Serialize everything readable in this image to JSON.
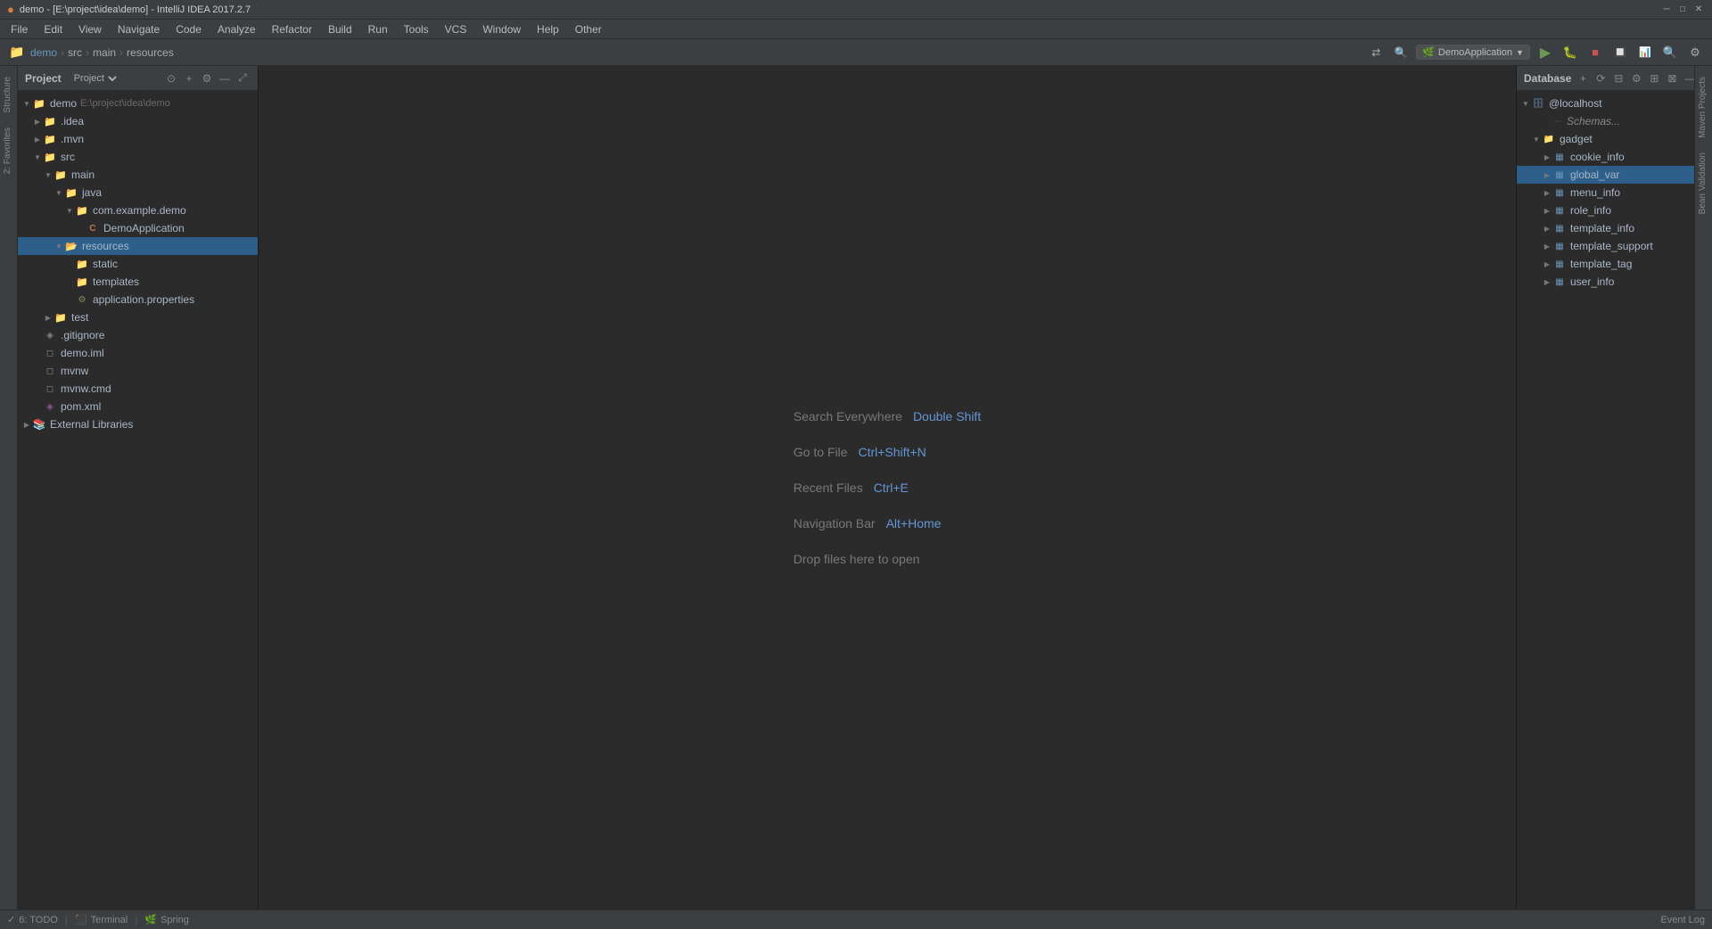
{
  "titleBar": {
    "title": "demo - [E:\\project\\idea\\demo] - IntelliJ IDEA 2017.2.7",
    "controls": [
      "─",
      "□",
      "✕"
    ]
  },
  "menuBar": {
    "items": [
      "File",
      "Edit",
      "View",
      "Navigate",
      "Code",
      "Analyze",
      "Refactor",
      "Build",
      "Run",
      "Tools",
      "VCS",
      "Window",
      "Help",
      "Other"
    ]
  },
  "toolbar": {
    "breadcrumb": [
      "demo",
      "src",
      "main",
      "resources"
    ],
    "runConfig": "DemoApplication",
    "buttons": [
      "▶",
      "🐛",
      "⏹",
      "⟳",
      "📊",
      "🔍"
    ]
  },
  "projectPanel": {
    "title": "Project",
    "tree": [
      {
        "indent": 0,
        "arrow": "open",
        "icon": "folder",
        "label": "demo",
        "sublabel": "E:\\project\\idea\\demo"
      },
      {
        "indent": 1,
        "arrow": "open",
        "icon": "folder",
        "label": ".idea"
      },
      {
        "indent": 1,
        "arrow": "closed",
        "icon": "folder",
        "label": ".mvn"
      },
      {
        "indent": 1,
        "arrow": "open",
        "icon": "folder",
        "label": "src"
      },
      {
        "indent": 2,
        "arrow": "open",
        "icon": "folder",
        "label": "main"
      },
      {
        "indent": 3,
        "arrow": "open",
        "icon": "folder",
        "label": "java"
      },
      {
        "indent": 4,
        "arrow": "open",
        "icon": "folder",
        "label": "com.example.demo"
      },
      {
        "indent": 5,
        "arrow": "empty",
        "icon": "java",
        "label": "DemoApplication"
      },
      {
        "indent": 3,
        "arrow": "open",
        "icon": "folder-selected",
        "label": "resources",
        "selected": true
      },
      {
        "indent": 4,
        "arrow": "empty",
        "icon": "folder",
        "label": "static"
      },
      {
        "indent": 4,
        "arrow": "empty",
        "icon": "folder",
        "label": "templates"
      },
      {
        "indent": 4,
        "arrow": "empty",
        "icon": "properties",
        "label": "application.properties"
      },
      {
        "indent": 2,
        "arrow": "closed",
        "icon": "folder",
        "label": "test"
      },
      {
        "indent": 1,
        "arrow": "empty",
        "icon": "gitignore",
        "label": ".gitignore"
      },
      {
        "indent": 1,
        "arrow": "empty",
        "icon": "file",
        "label": "demo.iml"
      },
      {
        "indent": 1,
        "arrow": "empty",
        "icon": "file",
        "label": "mvnw"
      },
      {
        "indent": 1,
        "arrow": "empty",
        "icon": "file",
        "label": "mvnw.cmd"
      },
      {
        "indent": 1,
        "arrow": "empty",
        "icon": "xml",
        "label": "pom.xml"
      },
      {
        "indent": 0,
        "arrow": "closed",
        "icon": "folder",
        "label": "External Libraries"
      }
    ]
  },
  "editor": {
    "hints": [
      {
        "label": "Search Everywhere",
        "shortcut": "Double Shift"
      },
      {
        "label": "Go to File",
        "shortcut": "Ctrl+Shift+N"
      },
      {
        "label": "Recent Files",
        "shortcut": "Ctrl+E"
      },
      {
        "label": "Navigation Bar",
        "shortcut": "Alt+Home"
      },
      {
        "label": "Drop files here to open",
        "shortcut": ""
      }
    ]
  },
  "databasePanel": {
    "title": "Database",
    "host": "@localhost",
    "schemas": "Schemas...",
    "tree": [
      {
        "indent": 0,
        "arrow": "open",
        "icon": "db",
        "label": "@localhost"
      },
      {
        "indent": 1,
        "arrow": "empty",
        "icon": "schema",
        "label": "Schemas..."
      },
      {
        "indent": 1,
        "arrow": "open",
        "icon": "folder",
        "label": "gadget"
      },
      {
        "indent": 2,
        "arrow": "empty",
        "icon": "table",
        "label": "cookie_info",
        "selected": false
      },
      {
        "indent": 2,
        "arrow": "empty",
        "icon": "table",
        "label": "global_var",
        "selected": true
      },
      {
        "indent": 2,
        "arrow": "empty",
        "icon": "table",
        "label": "menu_info"
      },
      {
        "indent": 2,
        "arrow": "empty",
        "icon": "table",
        "label": "role_info"
      },
      {
        "indent": 2,
        "arrow": "empty",
        "icon": "table",
        "label": "template_info"
      },
      {
        "indent": 2,
        "arrow": "empty",
        "icon": "table",
        "label": "template_support"
      },
      {
        "indent": 2,
        "arrow": "empty",
        "icon": "table",
        "label": "template_tag"
      },
      {
        "indent": 2,
        "arrow": "empty",
        "icon": "table",
        "label": "user_info"
      }
    ]
  },
  "rightSideTabs": [
    "Maven Projects",
    "Bean Validation"
  ],
  "leftSideTabs": [
    "Structure",
    "2: Favorites"
  ],
  "statusBar": {
    "left": [
      {
        "icon": "✓",
        "label": "6: TODO"
      },
      {
        "icon": "⬛",
        "label": "Terminal"
      },
      {
        "icon": "🌿",
        "label": "Spring"
      }
    ],
    "right": [
      {
        "label": "Event Log"
      }
    ]
  }
}
